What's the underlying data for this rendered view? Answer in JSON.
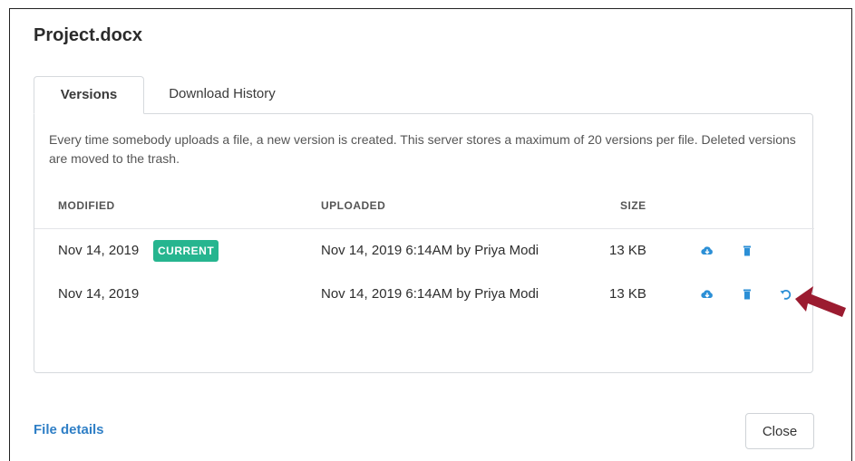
{
  "dialog": {
    "title": "Project.docx"
  },
  "tabs": [
    {
      "label": "Versions",
      "active": true
    },
    {
      "label": "Download History",
      "active": false
    }
  ],
  "description": "Every time somebody uploads a file, a new version is created. This server stores a maximum of 20 versions per file. Deleted versions are moved to the trash.",
  "table": {
    "headers": [
      "MODIFIED",
      "UPLOADED",
      "SIZE"
    ],
    "rows": [
      {
        "modified": "Nov 14, 2019",
        "badge": "CURRENT",
        "uploaded": "Nov 14, 2019 6:14AM by Priya Modi",
        "size": "13 KB",
        "actions": [
          "download-icon",
          "trash-icon"
        ]
      },
      {
        "modified": "Nov 14, 2019",
        "badge": "",
        "uploaded": "Nov 14, 2019 6:14AM by Priya Modi",
        "size": "13 KB",
        "actions": [
          "download-icon",
          "trash-icon",
          "restore-icon"
        ]
      }
    ]
  },
  "footer": {
    "link_label": "File details",
    "close_label": "Close"
  },
  "colors": {
    "accent": "#2f7fc6",
    "icon": "#2b8fd6",
    "badge": "#26b58f",
    "annotation_arrow": "#9b1b30"
  }
}
